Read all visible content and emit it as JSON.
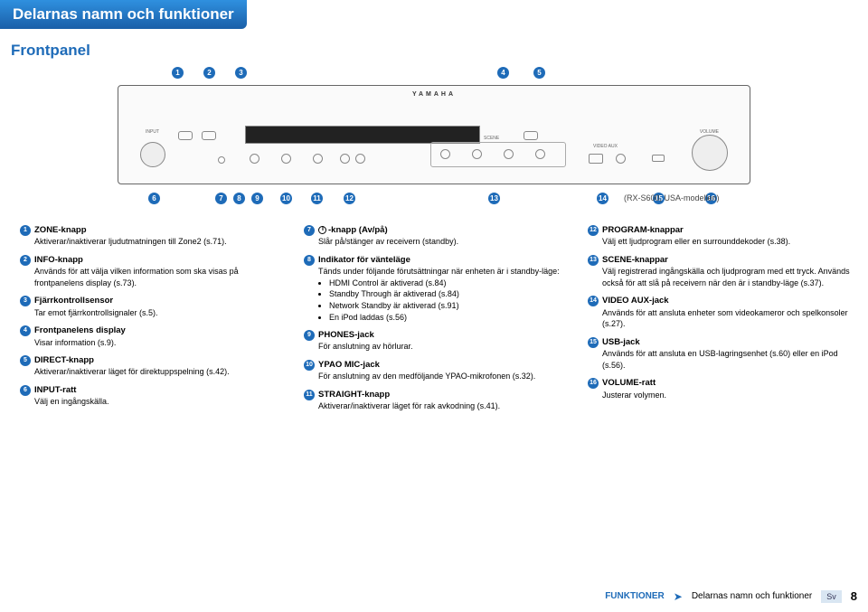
{
  "title": "Delarnas namn och funktioner",
  "subtitle": "Frontpanel",
  "panel": {
    "brand": "YAMAHA",
    "input_lbl": "INPUT",
    "volume_lbl": "VOLUME",
    "scene_lbl": "SCENE",
    "videoaux_lbl": "VIDEO AUX"
  },
  "markers_top": [
    "1",
    "2",
    "3",
    "4",
    "5"
  ],
  "markers_bot": [
    "6",
    "7",
    "8",
    "9",
    "10",
    "11",
    "12",
    "13",
    "14",
    "15",
    "16"
  ],
  "rx": "(RX-S600, USA-modellen)",
  "col1": [
    {
      "n": "1",
      "h": "ZONE-knapp",
      "d": "Aktiverar/inaktiverar ljudutmatningen till Zone2 (s.71)."
    },
    {
      "n": "2",
      "h": "INFO-knapp",
      "d": "Används för att välja vilken information som ska visas på frontpanelens display (s.73)."
    },
    {
      "n": "3",
      "h": "Fjärrkontrollsensor",
      "d": "Tar emot fjärrkontrollsignaler (s.5)."
    },
    {
      "n": "4",
      "h": "Frontpanelens display",
      "d": "Visar information (s.9)."
    },
    {
      "n": "5",
      "h": "DIRECT-knapp",
      "d": "Aktiverar/inaktiverar läget för direktuppspelning (s.42)."
    },
    {
      "n": "6",
      "h": "INPUT-ratt",
      "d": "Välj en ingångskälla."
    }
  ],
  "col2": [
    {
      "n": "7",
      "h": "-knapp (Av/på)",
      "pwr": true,
      "d": "Slår på/stänger av receivern (standby)."
    },
    {
      "n": "8",
      "h": "Indikator för vänteläge",
      "d": "Tänds under följande förutsättningar när enheten är i standby-läge:",
      "ul": [
        "HDMI Control är aktiverad (s.84)",
        "Standby Through är aktiverad (s.84)",
        "Network Standby är aktiverad (s.91)",
        "En iPod laddas (s.56)"
      ]
    },
    {
      "n": "9",
      "h": "PHONES-jack",
      "d": "För anslutning av hörlurar."
    },
    {
      "n": "10",
      "h": "YPAO MIC-jack",
      "d": "För anslutning av den medföljande YPAO-mikrofonen (s.32)."
    },
    {
      "n": "11",
      "h": "STRAIGHT-knapp",
      "d": "Aktiverar/inaktiverar läget för rak avkodning (s.41)."
    }
  ],
  "col3": [
    {
      "n": "12",
      "h": "PROGRAM-knappar",
      "d": "Välj ett ljudprogram eller en surrounddekoder (s.38)."
    },
    {
      "n": "13",
      "h": "SCENE-knappar",
      "d": "Välj registrerad ingångskälla och ljudprogram med ett tryck. Används också för att slå på receivern när den är i standby-läge (s.37)."
    },
    {
      "n": "14",
      "h": "VIDEO AUX-jack",
      "d": "Används för att ansluta enheter som videokameror och spelkonsoler (s.27)."
    },
    {
      "n": "15",
      "h": "USB-jack",
      "d": "Används för att ansluta en USB-lagringsenhet (s.60) eller en iPod (s.56)."
    },
    {
      "n": "16",
      "h": "VOLUME-ratt",
      "d": "Justerar volymen."
    }
  ],
  "footer": {
    "cat": "FUNKTIONER",
    "sep": "➤",
    "title": "Delarnas namn och funktioner",
    "sv": "Sv",
    "page": "8"
  }
}
